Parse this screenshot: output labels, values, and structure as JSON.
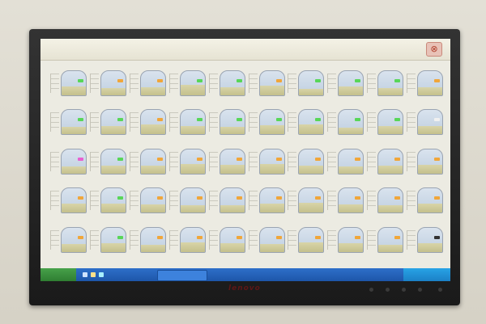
{
  "monitor": {
    "brand": "lenovo"
  },
  "app": {
    "close_glyph": "⊗"
  },
  "taskbar": {
    "start_label": ""
  },
  "tanks": [
    {
      "level": 0.38,
      "indicator": "#58d658"
    },
    {
      "level": 0.3,
      "indicator": "#f0a63a"
    },
    {
      "level": 0.34,
      "indicator": "#f0a63a"
    },
    {
      "level": 0.42,
      "indicator": "#58d658"
    },
    {
      "level": 0.32,
      "indicator": "#58d658"
    },
    {
      "level": 0.4,
      "indicator": "#f0a63a"
    },
    {
      "level": 0.28,
      "indicator": "#58d658"
    },
    {
      "level": 0.36,
      "indicator": "#58d658"
    },
    {
      "level": 0.3,
      "indicator": "#58d658"
    },
    {
      "level": 0.34,
      "indicator": "#f0a63a"
    },
    {
      "level": 0.32,
      "indicator": "#58d658"
    },
    {
      "level": 0.36,
      "indicator": "#58d658"
    },
    {
      "level": 0.4,
      "indicator": "#f0a63a"
    },
    {
      "level": 0.34,
      "indicator": "#58d658"
    },
    {
      "level": 0.3,
      "indicator": "#58d658"
    },
    {
      "level": 0.38,
      "indicator": "#58d658"
    },
    {
      "level": 0.42,
      "indicator": "#58d658"
    },
    {
      "level": 0.28,
      "indicator": "#58d658"
    },
    {
      "level": 0.34,
      "indicator": "#58d658"
    },
    {
      "level": 0.36,
      "indicator": "#f0f0f0"
    },
    {
      "level": 0.3,
      "indicator": "#e860d0"
    },
    {
      "level": 0.34,
      "indicator": "#58d658"
    },
    {
      "level": 0.32,
      "indicator": "#f0a63a"
    },
    {
      "level": 0.38,
      "indicator": "#f0a63a"
    },
    {
      "level": 0.36,
      "indicator": "#f0a63a"
    },
    {
      "level": 0.4,
      "indicator": "#f0a63a"
    },
    {
      "level": 0.34,
      "indicator": "#f0a63a"
    },
    {
      "level": 0.3,
      "indicator": "#f0a63a"
    },
    {
      "level": 0.32,
      "indicator": "#f0a63a"
    },
    {
      "level": 0.36,
      "indicator": "#f0a63a"
    },
    {
      "level": 0.36,
      "indicator": "#f0a63a"
    },
    {
      "level": 0.38,
      "indicator": "#58d658"
    },
    {
      "level": 0.34,
      "indicator": "#f0a63a"
    },
    {
      "level": 0.3,
      "indicator": "#f0a63a"
    },
    {
      "level": 0.32,
      "indicator": "#f0a63a"
    },
    {
      "level": 0.36,
      "indicator": "#f0a63a"
    },
    {
      "level": 0.4,
      "indicator": "#f0a63a"
    },
    {
      "level": 0.34,
      "indicator": "#f0a63a"
    },
    {
      "level": 0.3,
      "indicator": "#f0a63a"
    },
    {
      "level": 0.38,
      "indicator": "#f0a63a"
    },
    {
      "level": 0.32,
      "indicator": "#f0a63a"
    },
    {
      "level": 0.34,
      "indicator": "#58d658"
    },
    {
      "level": 0.3,
      "indicator": "#f0a63a"
    },
    {
      "level": 0.38,
      "indicator": "#f0a63a"
    },
    {
      "level": 0.36,
      "indicator": "#f0a63a"
    },
    {
      "level": 0.32,
      "indicator": "#f0a63a"
    },
    {
      "level": 0.4,
      "indicator": "#f0a63a"
    },
    {
      "level": 0.34,
      "indicator": "#f0a63a"
    },
    {
      "level": 0.3,
      "indicator": "#f0a63a"
    },
    {
      "level": 0.36,
      "indicator": "#333333"
    }
  ]
}
